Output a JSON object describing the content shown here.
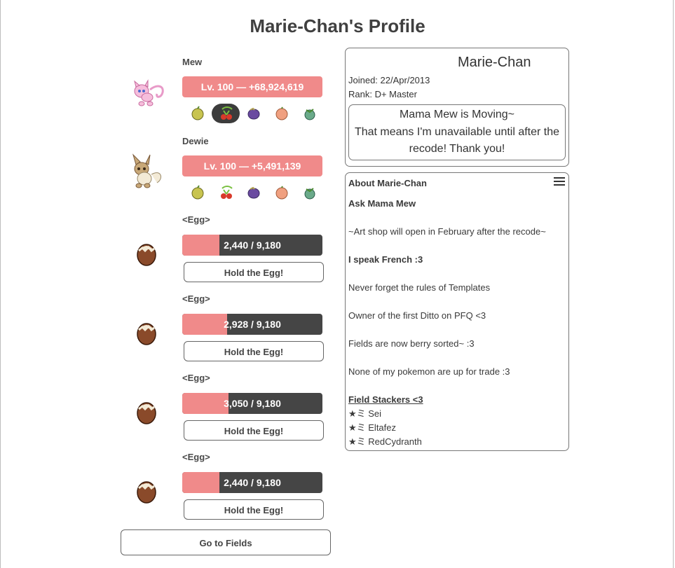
{
  "page": {
    "title": "Marie-Chan's Profile"
  },
  "party": [
    {
      "name": "Mew",
      "level_text": "Lv. 100 — +68,924,619",
      "sprite": "mew-sprite",
      "selected_berry": 1
    },
    {
      "name": "Dewie",
      "level_text": "Lv. 100 — +5,491,139",
      "sprite": "eevee-sprite",
      "selected_berry": -1
    }
  ],
  "berries": [
    {
      "icon": "aspear-berry-icon",
      "color": "#c8c450"
    },
    {
      "icon": "cheri-berry-icon",
      "color": "#d83a2a"
    },
    {
      "icon": "chesto-berry-icon",
      "color": "#6a4aa0"
    },
    {
      "icon": "pecha-berry-icon",
      "color": "#f0a080"
    },
    {
      "icon": "rawst-berry-icon",
      "color": "#6aaa8a"
    }
  ],
  "eggs": [
    {
      "name": "<Egg>",
      "progress_text": "2,440 / 9,180",
      "current": 2440,
      "total": 9180,
      "button": "Hold the Egg!"
    },
    {
      "name": "<Egg>",
      "progress_text": "2,928 / 9,180",
      "current": 2928,
      "total": 9180,
      "button": "Hold the Egg!"
    },
    {
      "name": "<Egg>",
      "progress_text": "3,050 / 9,180",
      "current": 3050,
      "total": 9180,
      "button": "Hold the Egg!"
    },
    {
      "name": "<Egg>",
      "progress_text": "2,440 / 9,180",
      "current": 2440,
      "total": 9180,
      "button": "Hold the Egg!"
    }
  ],
  "fields_button": "Go to Fields",
  "profile": {
    "name": "Marie-Chan",
    "joined": "Joined: 22/Apr/2013",
    "rank": "Rank: D+ Master",
    "status_lines": [
      "Mama Mew is Moving~",
      "That means I'm unavailable until after the",
      "recode! Thank you!"
    ]
  },
  "about": {
    "title": "About Marie-Chan",
    "lines": [
      {
        "text": "Ask Mama Mew",
        "style": "bold"
      },
      {
        "text": "",
        "style": ""
      },
      {
        "text": "~Art shop will open in February after the recode~",
        "style": ""
      },
      {
        "text": "",
        "style": ""
      },
      {
        "text": "I speak French :3",
        "style": "bold"
      },
      {
        "text": "",
        "style": ""
      },
      {
        "text": "Never forget the rules of Templates",
        "style": ""
      },
      {
        "text": "",
        "style": ""
      },
      {
        "text": "Owner of the first Ditto on PFQ <3",
        "style": ""
      },
      {
        "text": "",
        "style": ""
      },
      {
        "text": "Fields are now berry sorted~ :3",
        "style": ""
      },
      {
        "text": "",
        "style": ""
      },
      {
        "text": "None of my pokemon are up for trade :3",
        "style": ""
      },
      {
        "text": "",
        "style": ""
      },
      {
        "text": "Field Stackers <3",
        "style": "bold ul"
      },
      {
        "text": "★ミ Sei",
        "style": ""
      },
      {
        "text": "★ミ Eltafez",
        "style": ""
      },
      {
        "text": "★ミ RedCydranth",
        "style": ""
      }
    ]
  },
  "colors": {
    "accent": "#f08a8a",
    "dark": "#454545",
    "border": "#777777"
  }
}
